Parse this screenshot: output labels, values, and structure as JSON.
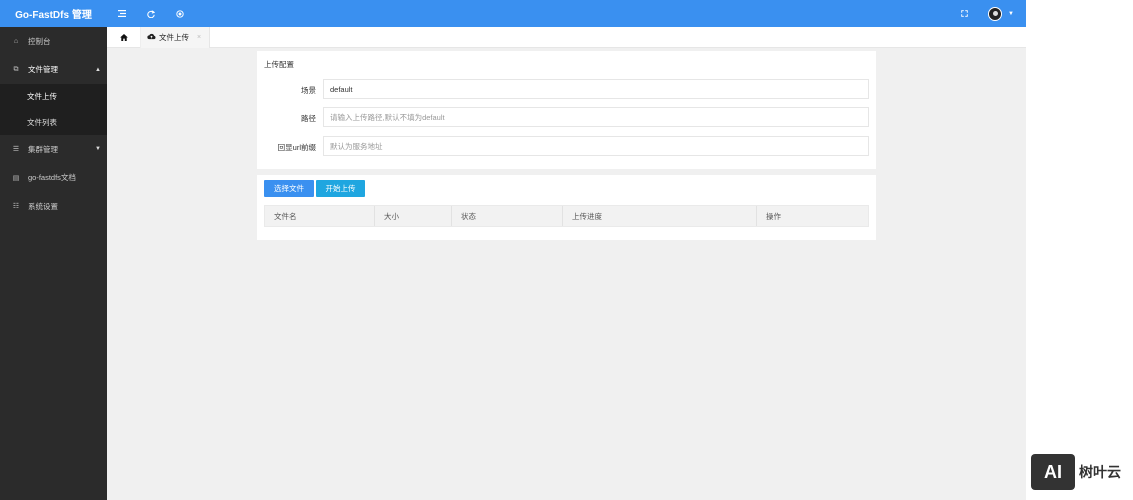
{
  "header": {
    "logo": "Go-FastDfs 管理",
    "icons": [
      "menu-icon",
      "refresh-icon",
      "target-icon",
      "fullscreen-icon"
    ],
    "accent_color": "#3a90f0"
  },
  "sidebar": {
    "items": [
      {
        "icon": "home-icon",
        "label": "控制台"
      },
      {
        "icon": "files-icon",
        "label": "文件管理"
      },
      {
        "icon": "cluster-icon",
        "label": "集群管理"
      },
      {
        "icon": "book-icon",
        "label": "go-fastdfs文档"
      },
      {
        "icon": "sliders-icon",
        "label": "系统设置"
      }
    ],
    "sub_items": [
      {
        "label": "文件上传"
      },
      {
        "label": "文件列表"
      }
    ]
  },
  "tabs": {
    "home_icon": "home-icon",
    "active_tab": {
      "label": "文件上传",
      "icon": "cloud-upload-icon"
    },
    "close_glyph": "×"
  },
  "upload_config": {
    "title": "上传配置",
    "fields": [
      {
        "label": "场景",
        "value": "default",
        "placeholder": ""
      },
      {
        "label": "路径",
        "value": "",
        "placeholder": "请输入上传路径,默认不填为default"
      },
      {
        "label": "回显url前缀",
        "value": "",
        "placeholder": "默认为服务地址"
      }
    ]
  },
  "upload_panel": {
    "select_button": "选择文件",
    "start_button": "开始上传",
    "select_color": "#3a90f0",
    "start_color": "#1fa6e0",
    "columns": [
      "文件名",
      "大小",
      "状态",
      "上传进度",
      "操作"
    ]
  },
  "watermark": {
    "logo": "AI",
    "text": "树叶云"
  }
}
